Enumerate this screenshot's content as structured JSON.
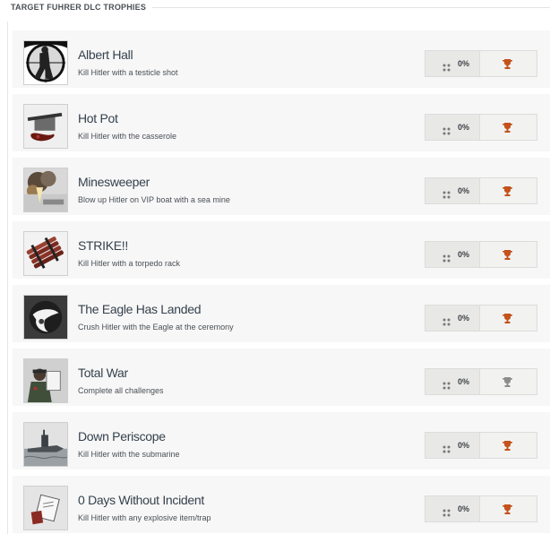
{
  "header": {
    "title": "TARGET FUHRER DLC TROPHIES"
  },
  "trophies": [
    {
      "title": "Albert Hall",
      "description": "Kill Hitler with a testicle shot",
      "percent": "0%",
      "icon": "rifle-scope-icon",
      "tier_color": "#c4521c"
    },
    {
      "title": "Hot Pot",
      "description": "Kill Hitler with the casserole",
      "percent": "0%",
      "icon": "casserole-icon",
      "tier_color": "#c4521c"
    },
    {
      "title": "Minesweeper",
      "description": "Blow up Hitler on VIP boat with a sea mine",
      "percent": "0%",
      "icon": "explosion-icon",
      "tier_color": "#c4521c"
    },
    {
      "title": "STRIKE!!",
      "description": "Kill Hitler with a torpedo rack",
      "percent": "0%",
      "icon": "torpedo-rack-icon",
      "tier_color": "#c4521c"
    },
    {
      "title": "The Eagle Has Landed",
      "description": "Crush Hitler with the Eagle at the ceremony",
      "percent": "0%",
      "icon": "eagle-icon",
      "tier_color": "#c4521c"
    },
    {
      "title": "Total War",
      "description": "Complete all challenges",
      "percent": "0%",
      "icon": "officer-icon",
      "tier_color": "#8d8d8d"
    },
    {
      "title": "Down Periscope",
      "description": "Kill Hitler with the submarine",
      "percent": "0%",
      "icon": "submarine-icon",
      "tier_color": "#c4521c"
    },
    {
      "title": "0 Days Without Incident",
      "description": "Kill Hitler with any explosive item/trap",
      "percent": "0%",
      "icon": "explosive-icon",
      "tier_color": "#c4521c"
    }
  ]
}
